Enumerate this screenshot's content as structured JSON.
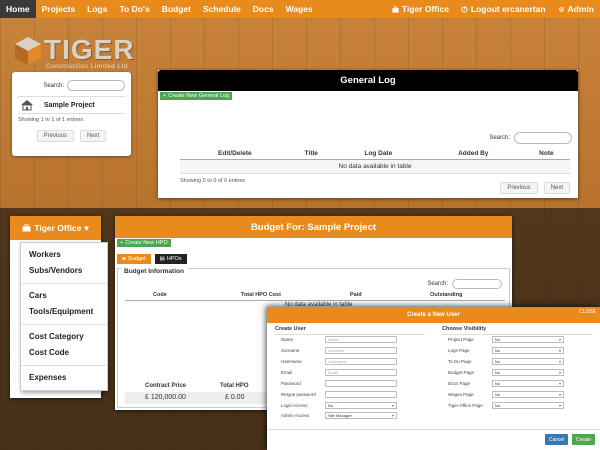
{
  "nav": {
    "items": [
      "Home",
      "Projects",
      "Logs",
      "To Do's",
      "Budget",
      "Schedule",
      "Docs",
      "Wages"
    ],
    "right": [
      "Tiger Office",
      "Logout ercanertan",
      "Admin"
    ]
  },
  "logo": {
    "word": "TIGER",
    "tagline": "Construction Limited Ltd"
  },
  "project_card": {
    "search_label": "Search:",
    "project_name": "Sample Project",
    "info": "Showing 1 to 1 of 1 entries",
    "prev": "Previous",
    "next": "Next"
  },
  "general_log": {
    "title": "General Log",
    "new_button": "Create New General Log",
    "search_label": "Search:",
    "columns": [
      "Edit/Delete",
      "Title",
      "Log Date",
      "Added By",
      "Note"
    ],
    "empty": "No data available in table",
    "info": "Showing 0 to 0 of 0 entries",
    "prev": "Previous",
    "next": "Next"
  },
  "office": {
    "title": "Tiger Office",
    "menu": [
      [
        "Workers",
        "Subs/Vendors"
      ],
      [
        "Cars",
        "Tools/Equipment"
      ],
      [
        "Cost Category",
        "Cost Code"
      ],
      [
        "Expenses"
      ]
    ]
  },
  "budget": {
    "title": "Budget For: Sample Project",
    "new_button": "Create New HPO",
    "tabs": [
      "Budget",
      "HPOs"
    ],
    "section": "Budget Information",
    "search_label": "Search:",
    "columns": [
      "Code",
      "Total HPO Cost",
      "Paid",
      "Outstanding"
    ],
    "empty": "No data available in table",
    "totals_headers": [
      "Contract Price",
      "Total HPO"
    ],
    "totals_values": [
      "£ 120,000.00",
      "£ 0.00"
    ]
  },
  "modal": {
    "title": "Create a New User",
    "close": "CLOSE",
    "left_title": "Create User",
    "right_title": "Choose Visibility",
    "fields": [
      {
        "label": "Name",
        "placeholder": "Name"
      },
      {
        "label": "Surname",
        "placeholder": "Surname"
      },
      {
        "label": "Username",
        "placeholder": "Username"
      },
      {
        "label": "Email",
        "placeholder": "Email"
      },
      {
        "label": "Password",
        "placeholder": ""
      },
      {
        "label": "Retype password",
        "placeholder": ""
      }
    ],
    "selects": [
      {
        "label": "Login Access",
        "value": "No"
      },
      {
        "label": "Admin Access",
        "value": "Site Manager"
      }
    ],
    "visibility": [
      {
        "label": "Project Page",
        "value": "No"
      },
      {
        "label": "Logs Page",
        "value": "No"
      },
      {
        "label": "To Do Page",
        "value": "No"
      },
      {
        "label": "Budget Page",
        "value": "No"
      },
      {
        "label": "Docs Page",
        "value": "No"
      },
      {
        "label": "Wages Page",
        "value": "No"
      },
      {
        "label": "Tiger Office Page",
        "value": "No"
      }
    ],
    "cancel": "Cancel",
    "create": "Create"
  },
  "colors": {
    "accent": "#e98a1c",
    "green": "#4ca84c",
    "blue": "#337ab7"
  }
}
